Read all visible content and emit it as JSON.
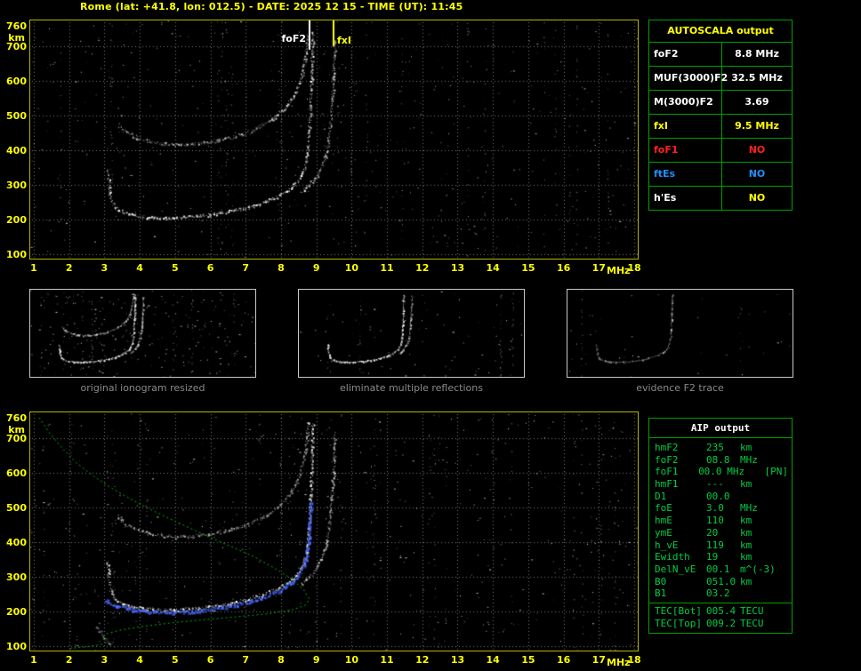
{
  "title": "Rome (lat: +41.8, lon: 012.5) - DATE: 2025 12 15 - TIME (UT): 11:45",
  "colors": {
    "accent_yellow": "#ffff00",
    "table_green": "#00a000",
    "aip_text_green": "#00cc44",
    "trace_white": "#ffffff",
    "restored_blue": "#4a6aff",
    "profile_green": "#00b400",
    "grid_gray": "#7a7a7a",
    "caption_gray": "#8a8a8a",
    "alert_red": "#ff2020",
    "info_blue": "#1e90ff"
  },
  "autoscala_table": {
    "header": "AUTOSCALA output",
    "rows": [
      {
        "label": "foF2",
        "value": "8.8 MHz",
        "label_color": "#ffffff",
        "value_color": "#ffffff"
      },
      {
        "label": "MUF(3000)F2",
        "value": "32.5 MHz",
        "label_color": "#ffffff",
        "value_color": "#ffffff"
      },
      {
        "label": "M(3000)F2",
        "value": "3.69",
        "label_color": "#ffffff",
        "value_color": "#ffffff"
      },
      {
        "label": "fxI",
        "value": "9.5 MHz",
        "label_color": "#ffff00",
        "value_color": "#ffff00"
      },
      {
        "label": "foF1",
        "value": "NO",
        "label_color": "#ff2020",
        "value_color": "#ff2020"
      },
      {
        "label": "ftEs",
        "value": "NO",
        "label_color": "#1e90ff",
        "value_color": "#1e90ff"
      },
      {
        "label": "h'Es",
        "value": "NO",
        "label_color": "#ffffff",
        "value_color": "#ffff00"
      }
    ]
  },
  "aip_table": {
    "header": "AIP output",
    "rows": [
      {
        "name": "hmF2",
        "value": "235",
        "unit": "km"
      },
      {
        "name": "foF2",
        "value": "08.8",
        "unit": "MHz"
      },
      {
        "name": "foF1",
        "value": "00.0",
        "unit": "MHz",
        "extra": "[PN]"
      },
      {
        "name": "hmF1",
        "value": "---",
        "unit": "km"
      },
      {
        "name": "D1",
        "value": "00.0",
        "unit": ""
      },
      {
        "name": "foE",
        "value": "3.0",
        "unit": "MHz"
      },
      {
        "name": "hmE",
        "value": "110",
        "unit": "km"
      },
      {
        "name": "ymE",
        "value": "20",
        "unit": "km"
      },
      {
        "name": "h_vE",
        "value": "119",
        "unit": "km"
      },
      {
        "name": "Ewidth",
        "value": "19",
        "unit": "km"
      },
      {
        "name": "DelN_vE",
        "value": "00.1",
        "unit": "m^(-3)"
      },
      {
        "name": "B0",
        "value": "051.0",
        "unit": "km"
      },
      {
        "name": "B1",
        "value": "03.2",
        "unit": ""
      }
    ],
    "tec_rows": [
      {
        "name": "TEC[Bot]",
        "value": "005.4",
        "unit": "TECU"
      },
      {
        "name": "TEC[Top]",
        "value": "009.2",
        "unit": "TECU"
      }
    ]
  },
  "thumbnails": [
    {
      "caption": "original ionogram resized"
    },
    {
      "caption": "eliminate multiple reflections"
    },
    {
      "caption": "evidence F2 trace"
    }
  ],
  "chart_data": {
    "type": "scatter",
    "title": "Ionogram: virtual height (km) vs sounding frequency (MHz)",
    "xlabel": "MHz",
    "ylabel": "km",
    "xlim": [
      0.9,
      18.1
    ],
    "ylim": [
      87,
      775
    ],
    "x_ticks": [
      1,
      2,
      3,
      4,
      5,
      6,
      7,
      8,
      9,
      10,
      11,
      12,
      13,
      14,
      15,
      16,
      17,
      18
    ],
    "y_ticks": [
      760,
      700,
      600,
      500,
      400,
      300,
      200,
      100
    ],
    "grid": "dotted-gray",
    "traces": {
      "f2_first_hop": [
        [
          3.08,
          345
        ],
        [
          3.12,
          300
        ],
        [
          3.18,
          262
        ],
        [
          3.28,
          238
        ],
        [
          3.5,
          222
        ],
        [
          3.8,
          213
        ],
        [
          4.2,
          208
        ],
        [
          4.7,
          205
        ],
        [
          5.2,
          207
        ],
        [
          5.7,
          211
        ],
        [
          6.2,
          218
        ],
        [
          6.7,
          227
        ],
        [
          7.1,
          237
        ],
        [
          7.5,
          250
        ],
        [
          7.9,
          266
        ],
        [
          8.2,
          285
        ],
        [
          8.45,
          308
        ],
        [
          8.6,
          334
        ],
        [
          8.7,
          368
        ],
        [
          8.76,
          412
        ],
        [
          8.8,
          470
        ],
        [
          8.83,
          540
        ],
        [
          8.86,
          615
        ],
        [
          8.88,
          700
        ],
        [
          8.89,
          745
        ]
      ],
      "f2_x_mode": [
        [
          8.55,
          278
        ],
        [
          8.75,
          296
        ],
        [
          8.95,
          318
        ],
        [
          9.1,
          345
        ],
        [
          9.25,
          385
        ],
        [
          9.35,
          440
        ],
        [
          9.42,
          510
        ],
        [
          9.47,
          590
        ],
        [
          9.5,
          665
        ],
        [
          9.51,
          720
        ]
      ],
      "second_hop": [
        [
          3.35,
          478
        ],
        [
          3.6,
          452
        ],
        [
          4.0,
          433
        ],
        [
          4.5,
          421
        ],
        [
          5.0,
          416
        ],
        [
          5.5,
          418
        ],
        [
          6.0,
          425
        ],
        [
          6.5,
          436
        ],
        [
          7.0,
          451
        ],
        [
          7.4,
          470
        ],
        [
          7.8,
          494
        ],
        [
          8.1,
          522
        ],
        [
          8.35,
          558
        ],
        [
          8.55,
          602
        ],
        [
          8.66,
          652
        ],
        [
          8.73,
          706
        ],
        [
          8.77,
          748
        ]
      ],
      "e_region": [
        [
          2.75,
          160
        ],
        [
          2.9,
          142
        ],
        [
          3.0,
          126
        ],
        [
          3.1,
          111
        ],
        [
          3.22,
          101
        ]
      ],
      "restored_f2": [
        [
          3.0,
          236
        ],
        [
          3.3,
          219
        ],
        [
          3.7,
          208
        ],
        [
          4.2,
          201
        ],
        [
          4.7,
          199
        ],
        [
          5.2,
          200
        ],
        [
          5.7,
          204
        ],
        [
          6.2,
          211
        ],
        [
          6.7,
          220
        ],
        [
          7.1,
          230
        ],
        [
          7.5,
          243
        ],
        [
          7.9,
          259
        ],
        [
          8.2,
          278
        ],
        [
          8.45,
          301
        ],
        [
          8.6,
          327
        ],
        [
          8.7,
          360
        ],
        [
          8.76,
          404
        ],
        [
          8.8,
          458
        ],
        [
          8.83,
          520
        ]
      ],
      "density_profile": [
        [
          1.15,
          760
        ],
        [
          1.45,
          715
        ],
        [
          1.8,
          672
        ],
        [
          2.2,
          630
        ],
        [
          2.7,
          590
        ],
        [
          3.3,
          550
        ],
        [
          4.0,
          510
        ],
        [
          4.8,
          470
        ],
        [
          5.6,
          432
        ],
        [
          6.4,
          396
        ],
        [
          7.2,
          360
        ],
        [
          7.8,
          326
        ],
        [
          8.3,
          294
        ],
        [
          8.65,
          262
        ],
        [
          8.8,
          236
        ],
        [
          8.7,
          218
        ],
        [
          8.3,
          204
        ],
        [
          7.6,
          193
        ],
        [
          6.7,
          184
        ],
        [
          5.8,
          176
        ],
        [
          4.9,
          167
        ],
        [
          4.1,
          157
        ],
        [
          3.5,
          147
        ],
        [
          3.1,
          137
        ],
        [
          2.95,
          127
        ],
        [
          3.0,
          117
        ],
        [
          3.05,
          110
        ],
        [
          2.9,
          104
        ],
        [
          2.5,
          98
        ],
        [
          2.0,
          93
        ]
      ]
    },
    "trace_styles": {
      "f2_first_hop": {
        "mode": "scatter",
        "color": "#ffffff",
        "alpha": 1
      },
      "f2_x_mode": {
        "mode": "scatter",
        "color": "#ffffff",
        "alpha": 0.75
      },
      "second_hop": {
        "mode": "scatter",
        "color": "#ffffff",
        "alpha": 0.7
      },
      "e_region": {
        "mode": "scatter",
        "color": "#ffffff",
        "alpha": 0.5
      },
      "restored_f2": {
        "mode": "scatter",
        "color": "#4a6aff",
        "alpha": 0.95,
        "size": 2
      },
      "density_profile": {
        "mode": "line",
        "color": "#00b400",
        "dash": [
          2,
          3
        ]
      }
    },
    "charts": [
      {
        "id": "main-ionogram",
        "series": [
          "f2_first_hop",
          "f2_x_mode",
          "second_hop"
        ],
        "noise_dots": 500,
        "noise_streaks": 24,
        "seed": 7,
        "markers": [
          {
            "label": "foF2",
            "x": 8.8,
            "color": "#ffffff",
            "len": 33
          },
          {
            "label": "fxI",
            "x": 9.5,
            "color": "#ffff00",
            "len": 29
          }
        ]
      },
      {
        "id": "profile-ionogram",
        "series": [
          "f2_first_hop",
          "f2_x_mode",
          "second_hop",
          "e_region",
          "restored_f2",
          "density_profile"
        ],
        "noise_dots": 560,
        "noise_streaks": 26,
        "seed": 13,
        "markers": []
      }
    ],
    "thumbnail_charts": [
      {
        "series": [
          "f2_first_hop",
          "f2_x_mode",
          "second_hop"
        ],
        "noise_dots": 240,
        "noise_streaks": 8,
        "seed": 3
      },
      {
        "series": [
          "f2_first_hop",
          "f2_x_mode"
        ],
        "noise_dots": 80,
        "noise_streaks": 4,
        "seed": 4
      },
      {
        "series": [
          "f2_first_hop"
        ],
        "noise_dots": 40,
        "noise_streaks": 2,
        "seed": 5,
        "alpha_mul": 0.55
      }
    ]
  }
}
